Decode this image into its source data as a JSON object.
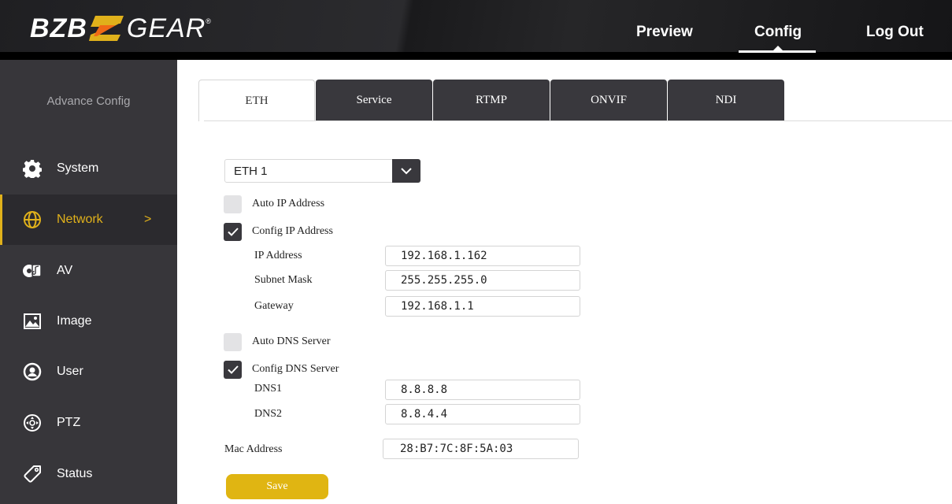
{
  "header": {
    "logo": {
      "left": "BZB",
      "right": "GEAR",
      "reg": "®"
    },
    "nav": {
      "preview": "Preview",
      "config": "Config",
      "logout": "Log Out"
    },
    "accent": "#e0b11b"
  },
  "sidebar": {
    "heading": "Advance Config",
    "items": [
      {
        "label": "System",
        "icon": "gear-icon"
      },
      {
        "label": "Network",
        "icon": "globe-icon",
        "active": true,
        "arrow": ">"
      },
      {
        "label": "AV",
        "icon": "av-icon"
      },
      {
        "label": "Image",
        "icon": "image-icon"
      },
      {
        "label": "User",
        "icon": "user-icon"
      },
      {
        "label": "PTZ",
        "icon": "ptz-icon"
      },
      {
        "label": "Status",
        "icon": "tag-icon"
      }
    ]
  },
  "tabs": [
    "ETH",
    "Service",
    "RTMP",
    "ONVIF",
    "NDI"
  ],
  "eth_select": {
    "value": "ETH 1"
  },
  "ip": {
    "auto_label": "Auto IP Address",
    "auto_checked": false,
    "config_label": "Config IP Address",
    "config_checked": true,
    "address_label": "IP Address",
    "address": "192.168.1.162",
    "subnet_label": "Subnet Mask",
    "subnet": "255.255.255.0",
    "gateway_label": "Gateway",
    "gateway": "192.168.1.1"
  },
  "dns": {
    "auto_label": "Auto DNS Server",
    "auto_checked": false,
    "config_label": "Config DNS Server",
    "config_checked": true,
    "dns1_label": "DNS1",
    "dns1": "8.8.8.8",
    "dns2_label": "DNS2",
    "dns2": "8.8.4.4"
  },
  "mac": {
    "label": "Mac Address",
    "value": "28:B7:7C:8F:5A:03"
  },
  "save_label": "Save"
}
